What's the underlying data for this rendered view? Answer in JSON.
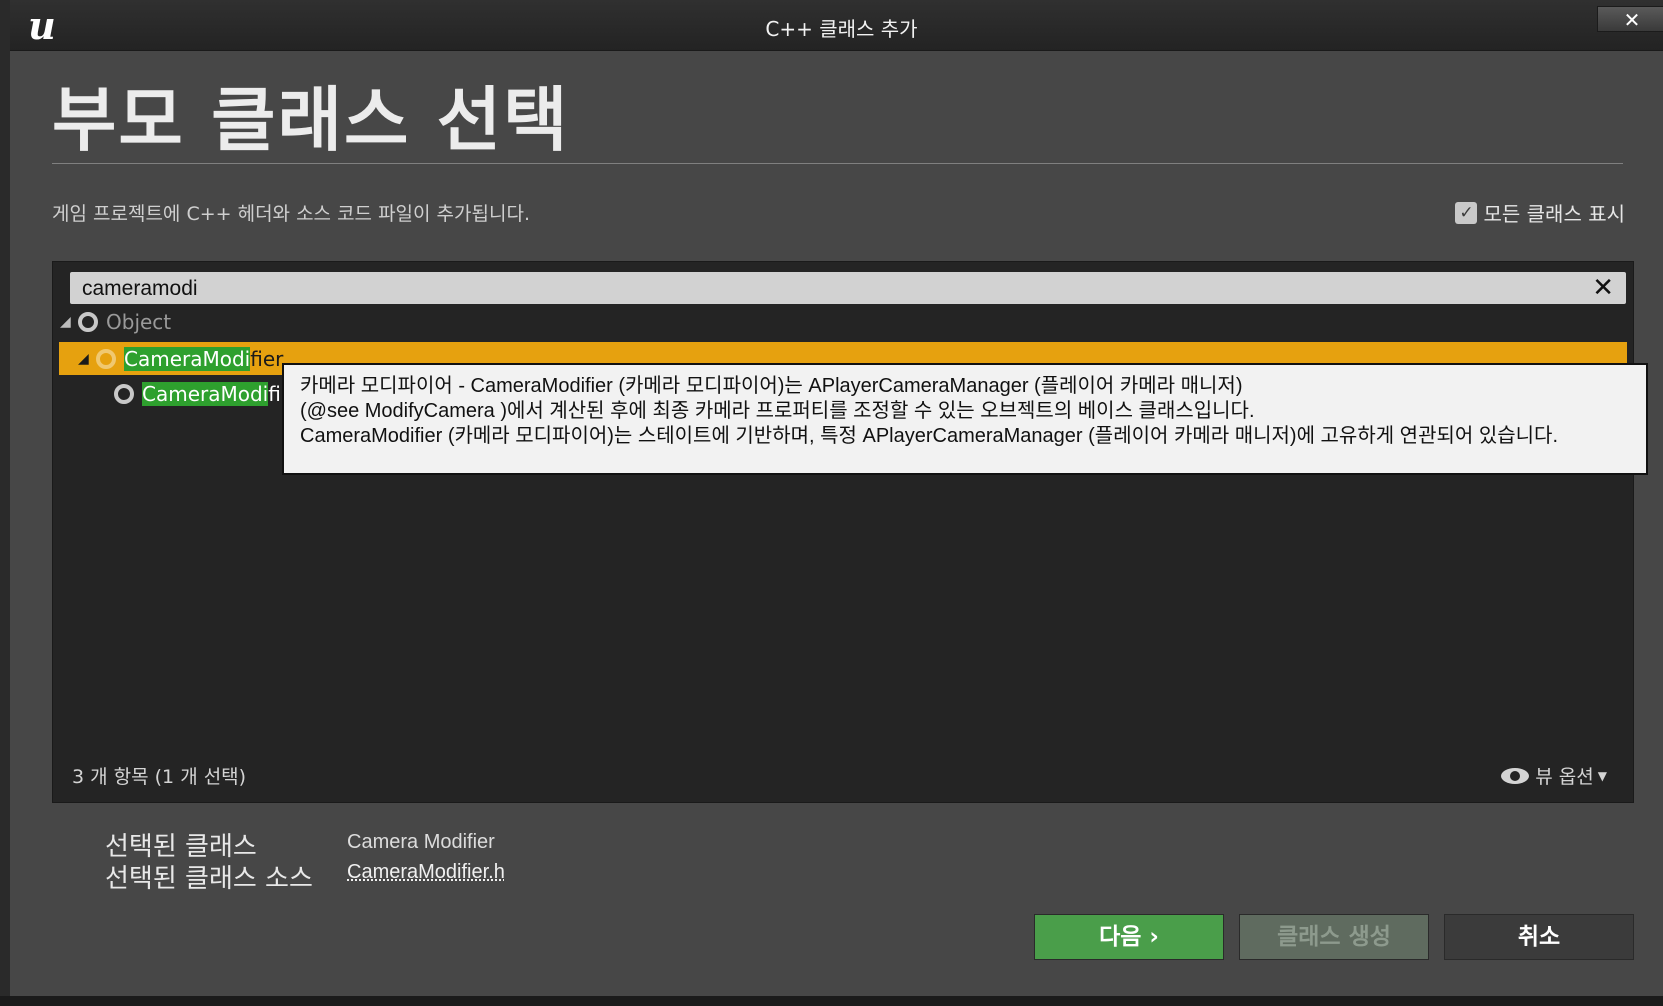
{
  "window": {
    "title": "C++ 클래스 추가",
    "close_label": "✕"
  },
  "header": {
    "heading": "부모 클래스 선택",
    "subtitle": "게임 프로젝트에 C++ 헤더와 소스 코드 파일이 추가됩니다.",
    "show_all_label": "모든 클래스 표시",
    "show_all_checked": true
  },
  "search": {
    "value": "cameramodi"
  },
  "tree": {
    "object_label": "Object",
    "selected_match": "CameraModi",
    "selected_rest": "fier",
    "child_match": "CameraModi",
    "child_rest": "fi"
  },
  "tooltip": {
    "line1": "카메라 모디파이어 - CameraModifier (카메라 모디파이어)는 APlayerCameraManager (플레이어 카메라 매니저)",
    "line2": "(@see ModifyCamera )에서 계산된 후에 최종 카메라 프로퍼티를 조정할 수 있는 오브젝트의 베이스 클래스입니다.",
    "line3": "CameraModifier (카메라 모디파이어)는 스테이트에 기반하며, 특정 APlayerCameraManager (플레이어 카메라 매니저)에 고유하게 연관되어 있습니다."
  },
  "footer": {
    "item_count": "3 개 항목 (1 개 선택)",
    "view_options": "뷰 옵션"
  },
  "selection": {
    "class_label": "선택된 클래스",
    "class_value": "Camera Modifier",
    "source_label": "선택된 클래스 소스",
    "source_value": "CameraModifier.h"
  },
  "buttons": {
    "next": "다음 ›",
    "create": "클래스 생성",
    "cancel": "취소"
  },
  "colors": {
    "selection": "#e6a10f",
    "match_highlight": "#2ea02e",
    "next_button": "#4a9e4a"
  }
}
